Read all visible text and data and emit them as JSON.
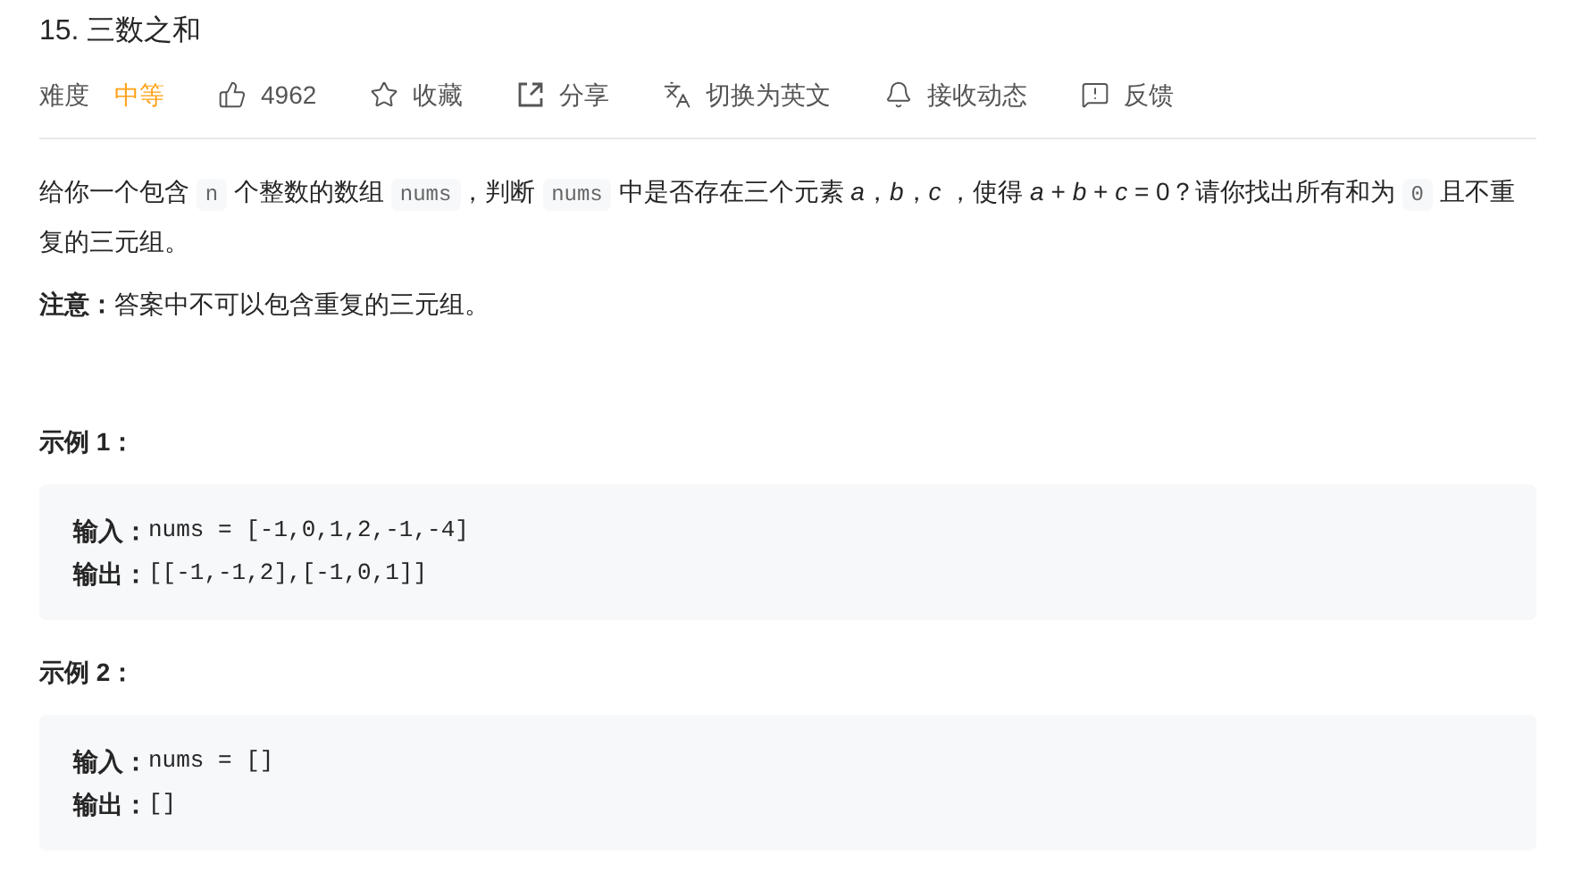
{
  "title": "15. 三数之和",
  "toolbar": [
    {
      "kind": "difficulty",
      "label": "难度",
      "value": "中等"
    },
    {
      "kind": "like",
      "label": "4962"
    },
    {
      "kind": "star",
      "label": "收藏"
    },
    {
      "kind": "share",
      "label": "分享"
    },
    {
      "kind": "translate",
      "label": "切换为英文"
    },
    {
      "kind": "bell",
      "label": "接收动态"
    },
    {
      "kind": "feedback",
      "label": "反馈"
    }
  ],
  "description": [
    {
      "kind": "text",
      "text": "给你一个包含 "
    },
    {
      "kind": "code",
      "text": "n"
    },
    {
      "kind": "text",
      "text": " 个整数的数组 "
    },
    {
      "kind": "code",
      "text": "nums"
    },
    {
      "kind": "text",
      "text": "，判断 "
    },
    {
      "kind": "code",
      "text": "nums"
    },
    {
      "kind": "text",
      "text": " 中是否存在三个元素 *a*，*b*，*c* ，使得 *a* + *b* + *c* = 0？请你找出所有和为 "
    },
    {
      "kind": "code",
      "text": "0"
    },
    {
      "kind": "text",
      "text": " 且不重复的三元组。"
    }
  ],
  "note": "**注意：**答案中不可以包含重复的三元组。",
  "examples": [
    {
      "title": "示例 1：",
      "lines": [
        {
          "label": "输入：",
          "value": "nums = [-1,0,1,2,-1,-4]"
        },
        {
          "label": "输出：",
          "value": "[[-1,-1,2],[-1,0,1]]"
        }
      ]
    },
    {
      "title": "示例 2：",
      "lines": [
        {
          "label": "输入：",
          "value": "nums = []"
        },
        {
          "label": "输出：",
          "value": "[]"
        }
      ]
    }
  ]
}
